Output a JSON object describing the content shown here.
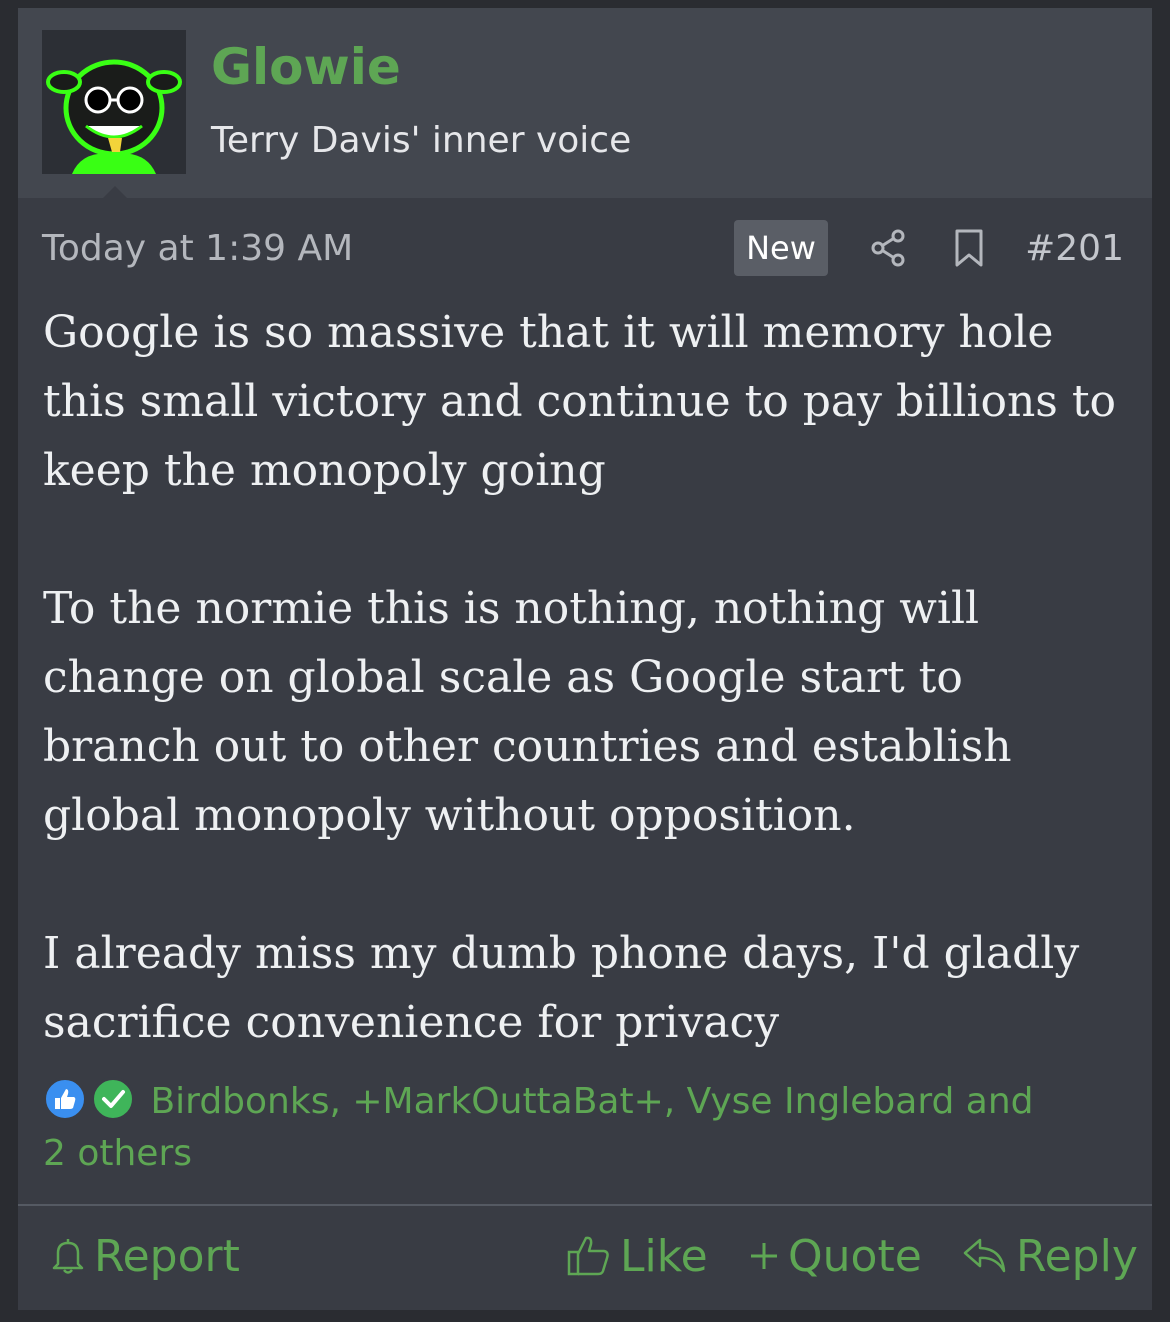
{
  "user": {
    "name": "Glowie",
    "title": "Terry Davis' inner voice"
  },
  "meta": {
    "timestamp": "Today at 1:39 AM",
    "badge": "New",
    "post_number": "#201"
  },
  "message": {
    "paragraphs": [
      "Google is so massive that it will memory hole this small victory and continue to pay billions to keep the monopoly going",
      "To the normie this is nothing, nothing will change on global scale as Google start to branch out to other countries and establish global monopoly without opposition.",
      "I already miss my dumb phone days, I'd gladly sacrifice convenience for privacy"
    ]
  },
  "reactions": {
    "types": [
      "like-icon",
      "check-icon"
    ],
    "summary": "Birdbonks, +MarkOuttaBat+, Vyse Inglebard and 2 others"
  },
  "actions": {
    "report": "Report",
    "like": "Like",
    "quote": "Quote",
    "reply": "Reply"
  },
  "colors": {
    "accent_green": "#5ea654",
    "post_bg": "#393c44",
    "header_bg": "#43474f"
  }
}
